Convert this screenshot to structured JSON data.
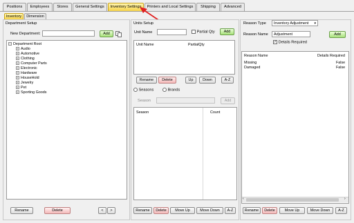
{
  "tabs": [
    {
      "label": "Positions"
    },
    {
      "label": "Employees"
    },
    {
      "label": "Stores"
    },
    {
      "label": "General Settings"
    },
    {
      "label": "Inventory Settings"
    },
    {
      "label": "Printers and Local Settings"
    },
    {
      "label": "Shipping"
    },
    {
      "label": "Advanced"
    }
  ],
  "subtabs": [
    {
      "label": "Inventory"
    },
    {
      "label": "Dimension"
    }
  ],
  "department": {
    "section_title": "Department Setup",
    "new_label": "New Department:",
    "new_value": "",
    "add_label": "Add",
    "tree_root": "Department Root",
    "tree_items": [
      "Audio",
      "Automotive",
      "Clothing",
      "Computer Parts",
      "Electronic",
      "Hardware",
      "HouseHold",
      "Jewelry",
      "Pet",
      "Sporting Goods"
    ],
    "rename_label": "Rename",
    "delete_label": "Delete",
    "prev_label": "<",
    "next_label": ">"
  },
  "units": {
    "section_title": "Units Setup",
    "unit_name_label": "Unit Name",
    "unit_name_value": "",
    "partial_label": "Partial Qty",
    "add_label": "Add",
    "col_name": "Unit Name",
    "col_partial": "PartialQty",
    "rename_label": "Rename",
    "delete_label": "Delete",
    "up_label": "Up",
    "down_label": "Down",
    "az_label": "A-Z",
    "seasons_label": "Seasons",
    "brands_label": "Brands",
    "season_label": "Season",
    "season_value": "",
    "season_add_label": "Add",
    "col_season": "Season",
    "col_count": "Count",
    "bottom_rename": "Rename",
    "bottom_delete": "Delete",
    "bottom_move_up": "Move Up",
    "bottom_move_down": "Move Down",
    "bottom_az": "A-Z"
  },
  "reason": {
    "type_label": "Reason Type",
    "type_value": "Inventory Adjustment",
    "name_label": "Reason Name",
    "name_value": "Adjustment",
    "add_label": "Add",
    "details_label": "Details Required",
    "details_checked": "✓",
    "col_name": "Reason Name",
    "col_details": "Details Required",
    "rows": [
      {
        "name": "Missing",
        "details": "False"
      },
      {
        "name": "Damaged",
        "details": "False"
      }
    ],
    "rename_label": "Rename",
    "delete_label": "Delete",
    "move_up_label": "Move Up",
    "move_down_label": "Move Down",
    "az_label": "A-Z"
  },
  "colors": {
    "active_tab": "#f6d34a",
    "add_green": "#a8e07a",
    "delete_red": "#f4b8b8",
    "arrow_red": "#e02020"
  },
  "icons": {
    "copy": "copy-icon",
    "arrow": "red-arrow-annotation",
    "expand": "plus-expander-icon",
    "collapse": "minus-expander-icon",
    "dropdown": "chevron-down-icon"
  }
}
